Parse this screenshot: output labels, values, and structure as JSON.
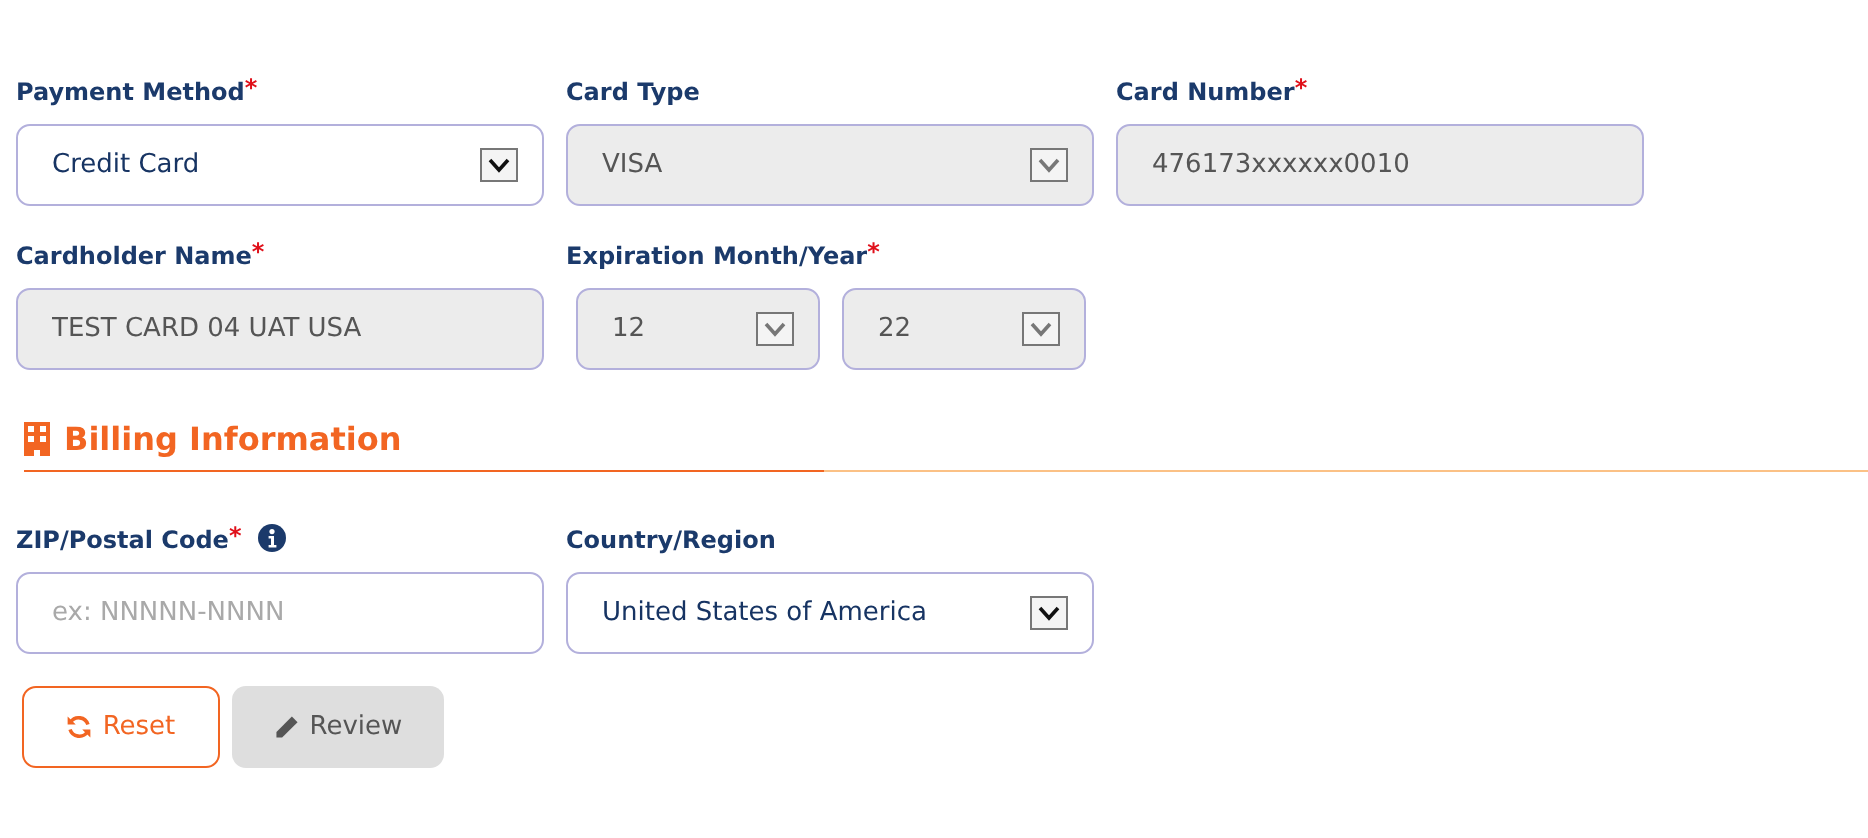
{
  "required_marker": "*",
  "payment": {
    "fields": [
      {
        "label": "Payment Method",
        "required": true,
        "kind": "select",
        "value": "Credit Card",
        "disabled": false
      },
      {
        "label": "Card Type",
        "required": false,
        "kind": "select",
        "value": "VISA",
        "disabled": true
      },
      {
        "label": "Card Number",
        "required": true,
        "kind": "text",
        "value": "476173xxxxxx0010",
        "disabled": true
      },
      {
        "label": "Cardholder Name",
        "required": true,
        "kind": "text",
        "value": "TEST CARD 04 UAT USA",
        "disabled": true
      },
      {
        "label": "Expiration Month/Year",
        "required": true,
        "kind": "pair",
        "parts": [
          {
            "value": "12",
            "disabled": true
          },
          {
            "value": "22",
            "disabled": true
          }
        ]
      }
    ]
  },
  "billing": {
    "title": "Billing Information",
    "fields": [
      {
        "label": "ZIP/Postal Code",
        "required": true,
        "info": true,
        "kind": "text",
        "placeholder": "ex: NNNNN-NNNN",
        "disabled": false
      },
      {
        "label": "Country/Region",
        "required": false,
        "info": false,
        "kind": "select",
        "value": "United States of America",
        "disabled": false
      }
    ]
  },
  "buttons": [
    {
      "label": "Reset",
      "kind": "reset",
      "disabled": false
    },
    {
      "label": "Review",
      "kind": "review",
      "disabled": true
    }
  ]
}
